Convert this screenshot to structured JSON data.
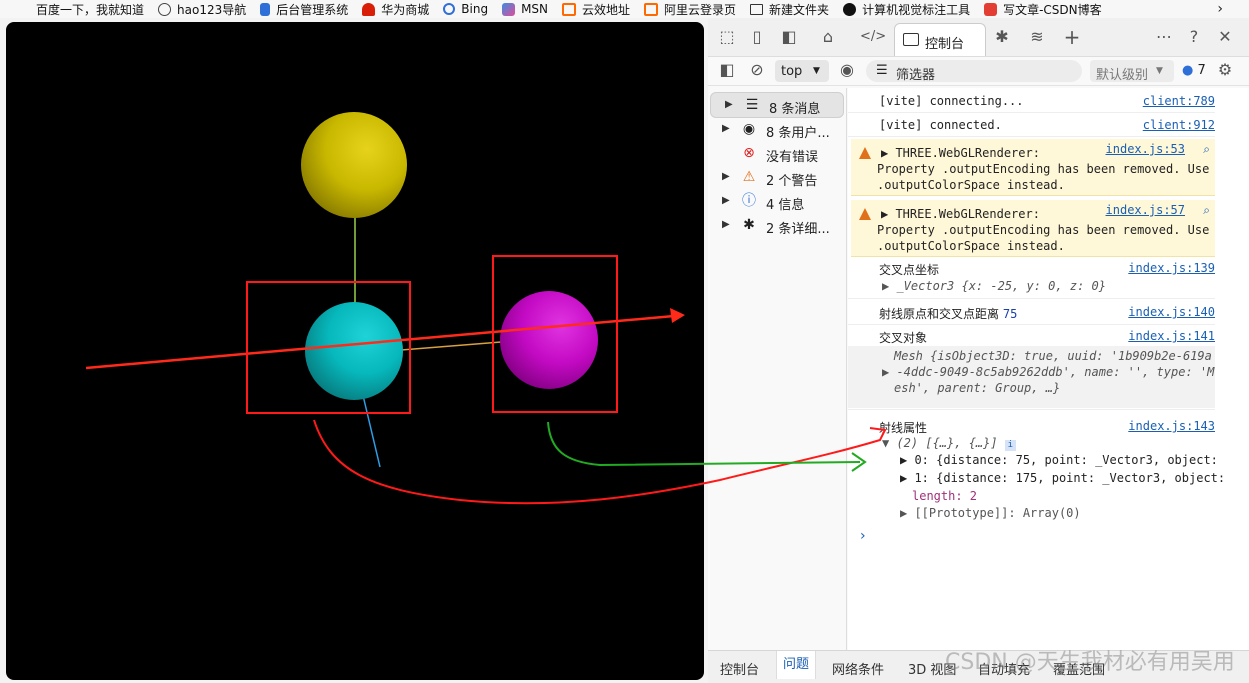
{
  "bookmarks": [
    {
      "label": "百度一下，我就知道",
      "icon": "none",
      "color": "#ffffff"
    },
    {
      "label": "hao123导航",
      "icon": "globe-icon",
      "color": "#444444"
    },
    {
      "label": "后台管理系统",
      "icon": "file-icon",
      "color": "#2f6fd8"
    },
    {
      "label": "华为商城",
      "icon": "huawei-logo-icon",
      "color": "#d81e06"
    },
    {
      "label": "Bing",
      "icon": "search-icon",
      "color": "#2f6fd8"
    },
    {
      "label": "MSN",
      "icon": "msn-logo-icon",
      "color": "#3a8de0"
    },
    {
      "label": "云效地址",
      "icon": "bracket-logo-icon",
      "color": "#ff6a00"
    },
    {
      "label": "阿里云登录页",
      "icon": "bracket-logo-icon",
      "color": "#ff6a00"
    },
    {
      "label": "新建文件夹",
      "icon": "folder-icon",
      "color": "#333333"
    },
    {
      "label": "计算机视觉标注工具",
      "icon": "arrow-logo-icon",
      "color": "#111111"
    },
    {
      "label": "写文章-CSDN博客",
      "icon": "csdn-logo-icon",
      "color": "#e33e33"
    }
  ],
  "devtools": {
    "active_tab": "控制台",
    "toolbar": {
      "context": "top",
      "filter_placeholder": "筛选器",
      "level": "默认级别",
      "issues_count": "7"
    },
    "sidebar": [
      {
        "label": "8 条消息",
        "icon": "list-icon",
        "expandable": true
      },
      {
        "label": "8 条用户...",
        "icon": "user-icon",
        "expandable": true
      },
      {
        "label": "没有错误",
        "icon": "error-icon",
        "expandable": false
      },
      {
        "label": "2 个警告",
        "icon": "warning-icon",
        "expandable": true
      },
      {
        "label": "4 信息",
        "icon": "info-icon",
        "expandable": true
      },
      {
        "label": "2 条详细...",
        "icon": "bug-icon",
        "expandable": true
      }
    ],
    "log": {
      "vite1": {
        "text": "[vite] connecting...",
        "source": "client:789"
      },
      "vite2": {
        "text": "[vite] connected.",
        "source": "client:912"
      },
      "warn1": {
        "title": "THREE.WebGLRenderer:",
        "line1": "Property .outputEncoding has been removed. Use",
        "line2": ".outputColorSpace instead.",
        "source": "index.js:53"
      },
      "warn2": {
        "title": "THREE.WebGLRenderer:",
        "line1": "Property .outputEncoding has been removed. Use",
        "line2": ".outputColorSpace instead.",
        "source": "index.js:57"
      },
      "point": {
        "label": "交叉点坐标",
        "source": "index.js:139",
        "value": "_Vector3 {x: -25, y: 0, z: 0}"
      },
      "dist": {
        "label": "射线原点和交叉点距离",
        "value": "75",
        "source": "index.js:140"
      },
      "obj": {
        "label": "交叉对象",
        "source": "index.js:141",
        "line1": "Mesh {isObject3D: true, uuid: '1b909b2e-619a",
        "line2": "-4ddc-9049-8c5ab9262ddb', name: '', type: 'M",
        "line3": "esh', parent: Group, …}"
      },
      "ray": {
        "label": "射线属性",
        "source": "index.js:143",
        "summary": "(2) [{…}, {…}]",
        "item0": "0: {distance: 75, point: _Vector3, object:",
        "item1": "1: {distance: 175, point: _Vector3, object:",
        "length": "length: 2",
        "proto": "[[Prototype]]: Array(0)"
      }
    },
    "drawer_tabs": [
      "控制台",
      "问题",
      "网络条件",
      "3D 视图",
      "自动填充",
      "覆盖范围"
    ],
    "drawer_active": "问题"
  },
  "watermark": "CSDN @天生我材必有用吴用"
}
